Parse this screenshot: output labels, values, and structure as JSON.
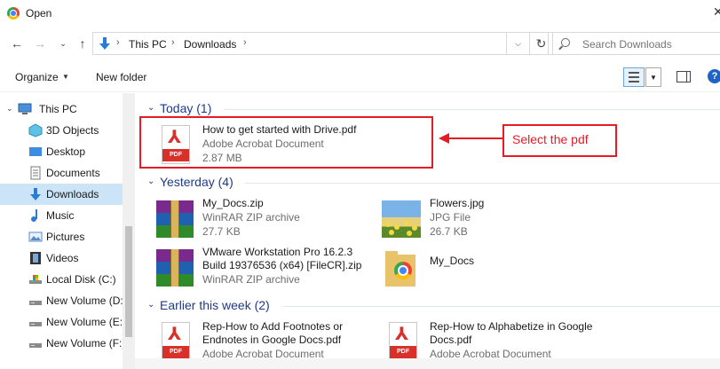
{
  "window": {
    "title": "Open"
  },
  "nav": {
    "breadcrumb": [
      "This PC",
      "Downloads"
    ],
    "search_placeholder": "Search Downloads"
  },
  "toolbar": {
    "organize_label": "Organize",
    "new_folder_label": "New folder"
  },
  "sidebar": {
    "items": [
      {
        "label": "This PC",
        "icon": "pc-icon"
      },
      {
        "label": "3D Objects",
        "icon": "cube-icon"
      },
      {
        "label": "Desktop",
        "icon": "desktop-icon"
      },
      {
        "label": "Documents",
        "icon": "documents-icon"
      },
      {
        "label": "Downloads",
        "icon": "download-arrow-icon",
        "selected": true
      },
      {
        "label": "Music",
        "icon": "music-note-icon"
      },
      {
        "label": "Pictures",
        "icon": "pictures-icon"
      },
      {
        "label": "Videos",
        "icon": "film-icon"
      },
      {
        "label": "Local Disk (C:)",
        "icon": "drive-icon"
      },
      {
        "label": "New Volume (D:",
        "icon": "drive-icon"
      },
      {
        "label": "New Volume (E:",
        "icon": "drive-icon"
      },
      {
        "label": "New Volume (F:)",
        "icon": "drive-icon"
      }
    ]
  },
  "groups": {
    "today": {
      "title": "Today (1)",
      "files": [
        {
          "name": "How to get started with Drive.pdf",
          "type": "Adobe Acrobat Document",
          "size": "2.87 MB",
          "icon": "pdf-icon"
        }
      ]
    },
    "yesterday": {
      "title": "Yesterday (4)",
      "files": [
        {
          "name": "My_Docs.zip",
          "type": "WinRAR ZIP archive",
          "size": "27.7 KB",
          "icon": "winrar-icon"
        },
        {
          "name": "Flowers.jpg",
          "type": "JPG File",
          "size": "26.7 KB",
          "icon": "image-thumbnail-icon"
        },
        {
          "name_line1": "VMware Workstation Pro 16.2.3",
          "name_line2": "Build 19376536 (x64) [FileCR].zip",
          "type": "WinRAR ZIP archive",
          "icon": "winrar-icon"
        },
        {
          "name": "My_Docs",
          "icon": "chrome-folder-icon"
        }
      ]
    },
    "earlier": {
      "title": "Earlier this week (2)",
      "files": [
        {
          "name_line1": "Rep-How to Add Footnotes or",
          "name_line2": "Endnotes in Google Docs.pdf",
          "type": "Adobe Acrobat Document",
          "icon": "pdf-icon"
        },
        {
          "name_line1": "Rep-How to Alphabetize in Google",
          "name_line2": "Docs.pdf",
          "type": "Adobe Acrobat Document",
          "icon": "pdf-icon"
        }
      ]
    }
  },
  "annotation": {
    "callout_text": "Select the pdf",
    "color": "#e51c24"
  },
  "colors": {
    "group_header": "#1e3a8a",
    "selected_bg": "#cce4f7",
    "pdf_red": "#d9302a"
  }
}
